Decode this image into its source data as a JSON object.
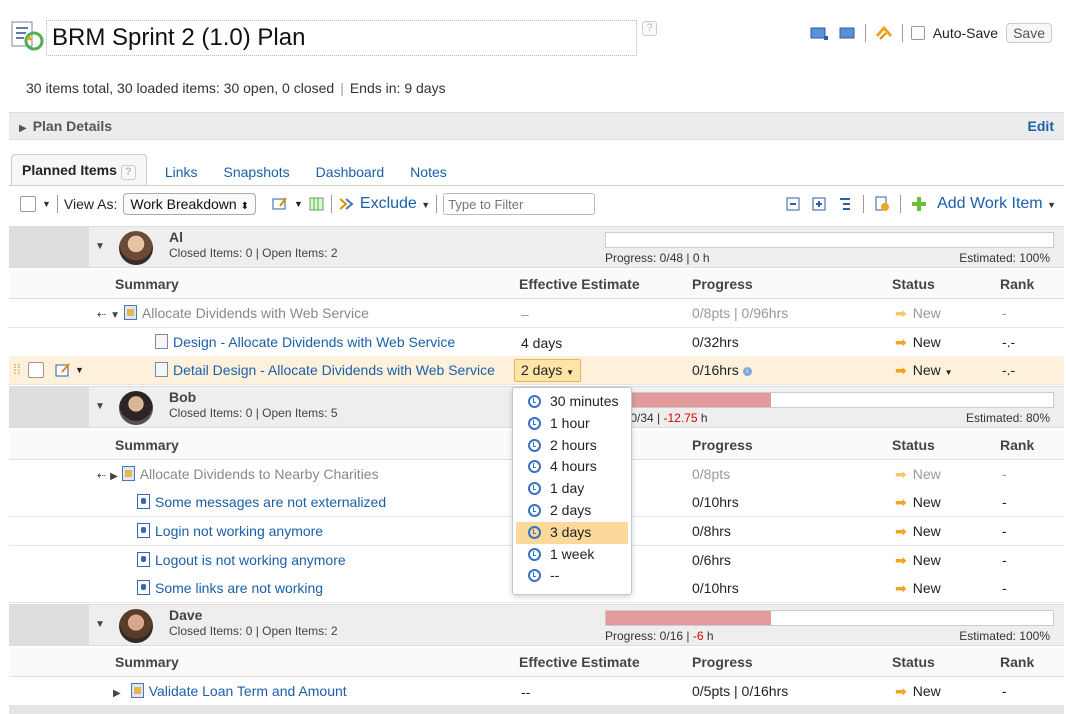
{
  "header": {
    "title": "BRM Sprint 2 (1.0) Plan",
    "help": "?",
    "auto_save_label": "Auto-Save",
    "save_label": "Save"
  },
  "summary": {
    "items": "30 items total, 30 loaded items:  30 open, 0 closed",
    "ends": "Ends in:  9 days"
  },
  "details": {
    "label": "Plan Details",
    "edit": "Edit"
  },
  "tabs": [
    {
      "label": "Planned Items"
    },
    {
      "label": "Links"
    },
    {
      "label": "Snapshots"
    },
    {
      "label": "Dashboard"
    },
    {
      "label": "Notes"
    }
  ],
  "toolbar": {
    "view_as_label": "View As:",
    "view_as_value": "Work Breakdown",
    "exclude": "Exclude",
    "filter_placeholder": "Type to Filter",
    "add_work_item": "Add Work Item"
  },
  "columns": {
    "summary": "Summary",
    "effective_estimate": "Effective Estimate",
    "progress": "Progress",
    "status": "Status",
    "rank": "Rank"
  },
  "groups": [
    {
      "name": "Al",
      "counts": "Closed Items: 0 | Open Items: 2",
      "progress_text": "Progress: 0/48 | 0 h",
      "progress_neg": "",
      "estimated": "Estimated: 100%",
      "fill_fraction": 0,
      "rows": [
        {
          "summary": "Allocate Dividends with Web Service",
          "estimate": "–",
          "progress": "0/8pts | 0/96hrs",
          "status": "New",
          "rank": "-"
        },
        {
          "summary": "Design - Allocate Dividends with Web Service",
          "estimate": "4 days",
          "progress": "0/32hrs",
          "status": "New",
          "rank": "-.-"
        },
        {
          "summary": "Detail Design - Allocate Dividends with Web Service",
          "estimate": "2 days",
          "progress": "0/16hrs",
          "status": "New",
          "rank": "-.-"
        }
      ]
    },
    {
      "name": "Bob",
      "counts": "Closed Items: 0 | Open Items: 5",
      "progress_text": "ess: 0/34 | ",
      "progress_neg": "-12.75",
      "progress_unit": " h",
      "estimated": "Estimated: 80%",
      "fill_fraction": 0.37,
      "rows": [
        {
          "summary": "Allocate Dividends to Nearby Charities",
          "progress": "0/8pts",
          "status": "New",
          "rank": "-"
        },
        {
          "summary": "Some messages are not externalized",
          "progress": "0/10hrs",
          "status": "New",
          "rank": "-"
        },
        {
          "summary": "Login not working anymore",
          "progress": "0/8hrs",
          "status": "New",
          "rank": "-"
        },
        {
          "summary": "Logout is not working anymore",
          "progress": "0/6hrs",
          "status": "New",
          "rank": "-"
        },
        {
          "summary": "Some links are not working",
          "progress": "0/10hrs",
          "status": "New",
          "rank": "-"
        }
      ]
    },
    {
      "name": "Dave",
      "counts": "Closed Items: 0 | Open Items: 2",
      "progress_text": "Progress: 0/16 | ",
      "progress_neg": "-6",
      "progress_unit": " h",
      "estimated": "Estimated: 100%",
      "fill_fraction": 0.37,
      "rows": [
        {
          "summary": "Validate Loan Term and Amount",
          "estimate": "--",
          "progress": "0/5pts | 0/16hrs",
          "status": "New",
          "rank": "-"
        }
      ]
    }
  ],
  "estimate_dropdown": {
    "options": [
      "30 minutes",
      "1 hour",
      "2 hours",
      "4 hours",
      "1 day",
      "2 days",
      "3 days",
      "1 week",
      "--"
    ],
    "highlighted": "3 days"
  }
}
